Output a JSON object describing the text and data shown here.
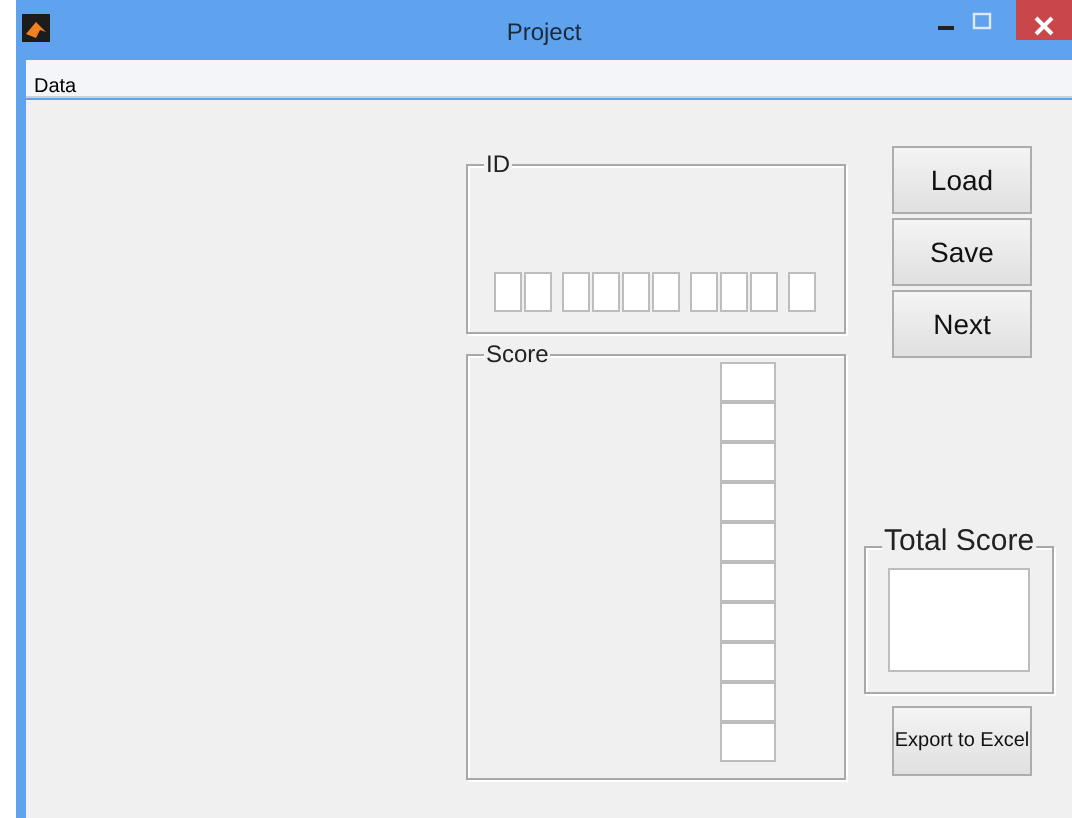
{
  "window": {
    "title": "Project"
  },
  "menu": [
    "Data"
  ],
  "id_panel": {
    "title": "ID",
    "field_groups": [
      {
        "fields": [
          {
            "kind": "edit"
          },
          {
            "kind": "edit"
          }
        ]
      },
      {
        "fields": [
          {
            "kind": "edit"
          },
          {
            "kind": "edit"
          },
          {
            "kind": "edit"
          },
          {
            "kind": "edit"
          }
        ]
      },
      {
        "fields": [
          {
            "kind": "edit"
          },
          {
            "kind": "edit"
          },
          {
            "kind": "edit"
          }
        ]
      },
      {
        "fields": [
          {
            "kind": "edit"
          }
        ]
      }
    ]
  },
  "buttons": [
    "Load",
    "Save",
    "Next"
  ],
  "score_panel": {
    "title": "Score",
    "fields": [
      {
        "kind": "edit"
      },
      {
        "kind": "edit"
      },
      {
        "kind": "edit"
      },
      {
        "kind": "edit"
      },
      {
        "kind": "edit"
      },
      {
        "kind": "edit"
      },
      {
        "kind": "edit"
      },
      {
        "kind": "edit"
      },
      {
        "kind": "edit"
      },
      {
        "kind": "edit"
      }
    ]
  },
  "total_panel": {
    "title": "Total Score",
    "fields": [
      {
        "kind": "edit"
      }
    ]
  },
  "export_button": "Export to Excel"
}
